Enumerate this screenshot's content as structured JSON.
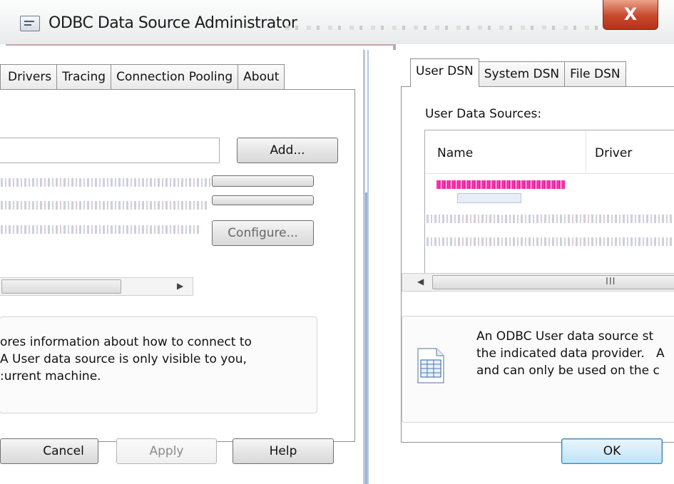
{
  "window": {
    "title": "ODBC Data Source Administrator",
    "close_label": "X"
  },
  "left_pane": {
    "tabs": [
      "Drivers",
      "Tracing",
      "Connection Pooling",
      "About"
    ],
    "add_button": "Add...",
    "configure_button": "Configure...",
    "info_lines": [
      "ores information about how to connect to",
      "A User data source is only visible to you,",
      ":urrent machine."
    ],
    "buttons": {
      "cancel": "Cancel",
      "apply": "Apply",
      "help": "Help"
    }
  },
  "right_pane": {
    "tabs": [
      "User DSN",
      "System DSN",
      "File DSN"
    ],
    "list_label": "User Data Sources:",
    "columns": [
      "Name",
      "Driver"
    ],
    "scroll_grip": "III",
    "info_lines": [
      "An ODBC User data source st",
      "the indicated data provider.   A",
      "and can only be used on the c"
    ],
    "ok_button": "OK"
  }
}
